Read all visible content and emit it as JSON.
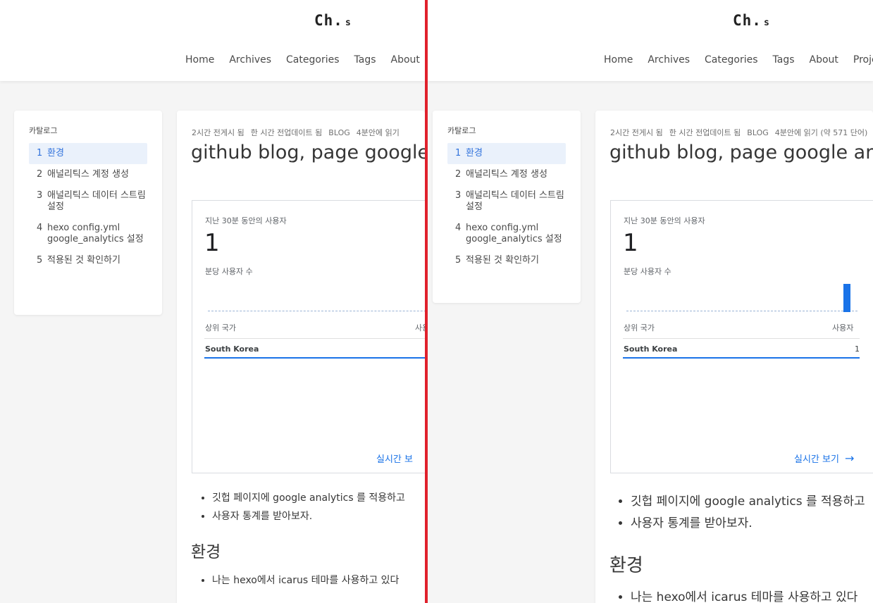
{
  "site": {
    "logo": "Ch.",
    "logo_suffix": "s",
    "nav": [
      "Home",
      "Archives",
      "Categories",
      "Tags",
      "About",
      "Project"
    ]
  },
  "toc": {
    "title": "카탈로그",
    "items": [
      {
        "num": "1",
        "label": "환경"
      },
      {
        "num": "2",
        "label": "애널리틱스 계정 생성"
      },
      {
        "num": "3",
        "label": "애널리틱스 데이터 스트림 설정"
      },
      {
        "num": "4",
        "label": "hexo config.yml google_analytics 설정"
      },
      {
        "num": "5",
        "label": "적용된 것 확인하기"
      }
    ]
  },
  "post": {
    "meta": [
      "2시간 전게시 됨",
      "한 시간 전업데이트 됨",
      "BLOG",
      "4분안에 읽기 (약 571 단어)"
    ],
    "meta_left": [
      "2시간 전게시 됨",
      "한 시간 전업데이트 됨",
      "BLOG",
      "4분안에 읽기"
    ],
    "title": "github blog, page google analytics",
    "bullets": [
      "깃헙 페이지에 google analytics 를 적용하고",
      "사용자 통계를 받아보자."
    ],
    "section": "환경",
    "section_bullet": "나는 hexo에서 icarus 테마를 사용하고 있다"
  },
  "ga": {
    "label": "지난 30분 동안의 사용자",
    "value": "1",
    "per_minute": "분당 사용자 수",
    "top_country": "상위 국가",
    "users": "사용자",
    "country": "South Korea",
    "country_value": "1",
    "link_full": "실시간 보기",
    "link_cut": "실시간 보",
    "bar_fraction": 1
  }
}
